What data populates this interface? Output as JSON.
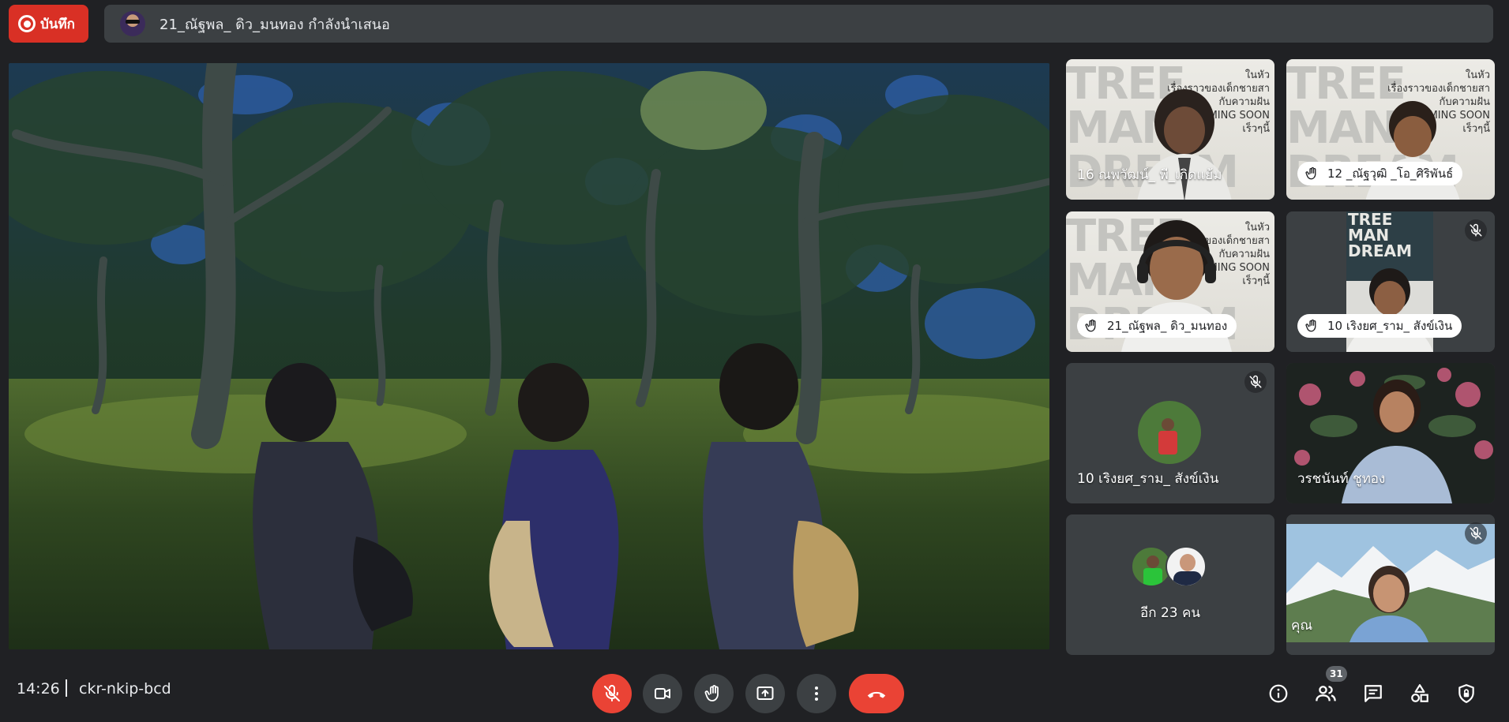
{
  "recording": {
    "label": "บันทึก"
  },
  "presenter_bar": {
    "text": "21_ณัฐพล_ ดิว_มนทอง กำลังนำเสนอ"
  },
  "tiles": [
    {
      "name": "16 ณพวัฒน์_ พี_เกิดแย้ม",
      "hand_raised": false,
      "muted": false,
      "poster_title": "TREE\nMAN\nDREAM",
      "poster_sub": "ในหัว\nเรื่องราวของเด็กชายสา\nกับความฝัน\nCOMING SOON\nเร็วๆนี้"
    },
    {
      "name": "12 _ณัฐวุฒิ _โอ_ศิริพันธ์",
      "hand_raised": true,
      "muted": false,
      "poster_title": "TREE\nMAN\nDREAM",
      "poster_sub": "ในหัว\nเรื่องราวของเด็กชายสา\nกับความฝัน\nCOMING SOON\nเร็วๆนี้"
    },
    {
      "name": "21_ณัฐพล_ ดิว_มนทอง",
      "hand_raised": true,
      "muted": false,
      "poster_title": "TREE\nMAN\nDREAM",
      "poster_sub": "ในหัว\nเรื่องราวของเด็กชายสา\nกับความฝัน\nCOMING SOON\nเร็วๆนี้"
    },
    {
      "name": "10 เริงยศ_ราม_ สังข์เงิน",
      "hand_raised": true,
      "muted": true,
      "poster_title": "TREE\nMAN\nDREAM"
    },
    {
      "name": "10 เริงยศ_ราม_ สังข์เงิน",
      "hand_raised": false,
      "muted": true
    },
    {
      "name": "วรชนันท์ ชูทอง",
      "hand_raised": false,
      "muted": false
    },
    {
      "name": "อีก 23 คน",
      "hand_raised": false,
      "muted": false
    },
    {
      "name": "คุณ",
      "hand_raised": false,
      "muted": true
    }
  ],
  "bottom": {
    "time": "14:26",
    "meeting_code": "ckr-nkip-bcd",
    "participant_count": "31"
  },
  "controls": {
    "mic": "mic-off-icon",
    "camera": "camera-icon",
    "hand": "raise-hand-icon",
    "present": "present-icon",
    "more": "more-vert-icon",
    "hangup": "hangup-icon"
  },
  "colors": {
    "background": "#202124",
    "surface": "#3c4043",
    "danger": "#ea4335",
    "record": "#d93025"
  }
}
